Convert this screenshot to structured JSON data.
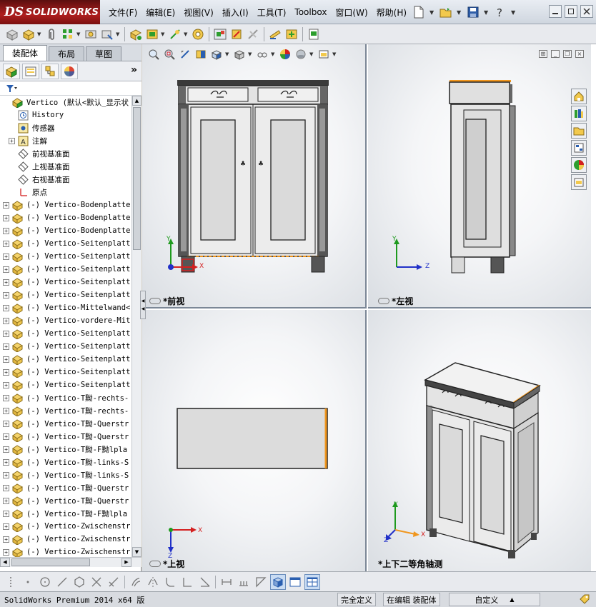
{
  "app": {
    "logo_ds": "DS",
    "logo_text": "SOLIDWORKS"
  },
  "menu": [
    "文件(F)",
    "编辑(E)",
    "视图(V)",
    "插入(I)",
    "工具(T)",
    "Toolbox",
    "窗口(W)",
    "帮助(H)"
  ],
  "panel_tabs": [
    "装配体",
    "布局",
    "草图"
  ],
  "tree": {
    "root": "Vertico  (默认<默认_显示状",
    "fixed_items": [
      "History",
      "传感器",
      "注解",
      "前视基准面",
      "上视基准面",
      "右视基准面",
      "原点"
    ],
    "components": [
      "(-) Vertico-Bodenplatte",
      "(-) Vertico-Bodenplatte",
      "(-) Vertico-Bodenplatte",
      "(-) Vertico-Seitenplatt",
      "(-) Vertico-Seitenplatt",
      "(-) Vertico-Seitenplatt",
      "(-) Vertico-Seitenplatt",
      "(-) Vertico-Seitenplatt",
      "(-) Vertico-Mittelwand<",
      "(-) Vertico-vordere-Mit",
      "(-) Vertico-Seitenplatt",
      "(-) Vertico-Seitenplatt",
      "(-) Vertico-Seitenplatt",
      "(-) Vertico-Seitenplatt",
      "(-) Vertico-Seitenplatt",
      "(-) Vertico-T黝-rechts-",
      "(-) Vertico-T黝-rechts-",
      "(-) Vertico-T黝-Querstr",
      "(-) Vertico-T黝-Querstr",
      "(-) Vertico-T黝-F黝lpla",
      "(-) Vertico-T黝-links-S",
      "(-) Vertico-T黝-links-S",
      "(-) Vertico-T黝-Querstr",
      "(-) Vertico-T黝-Querstr",
      "(-) Vertico-T黝-F黝lpla",
      "(-) Vertico-Zwischenstr",
      "(-) Vertico-Zwischenstr",
      "(-) Vertico-Zwischenstr"
    ]
  },
  "viewports": [
    {
      "label": "*前视"
    },
    {
      "label": "*左视"
    },
    {
      "label": "*上视"
    },
    {
      "label": "*上下二等角轴测"
    }
  ],
  "axes": {
    "x": "X",
    "y": "Y",
    "z": "Z"
  },
  "status": {
    "app_version": "SolidWorks Premium 2014 x64 版",
    "definition": "完全定义",
    "editing": "在编辑 装配体",
    "units": "自定义"
  },
  "colors": {
    "accent_orange": "#f0961e",
    "logo_red": "#b01e1e",
    "axis_x": "#d42020",
    "axis_y": "#1e9a1e",
    "axis_z": "#2030c8"
  }
}
